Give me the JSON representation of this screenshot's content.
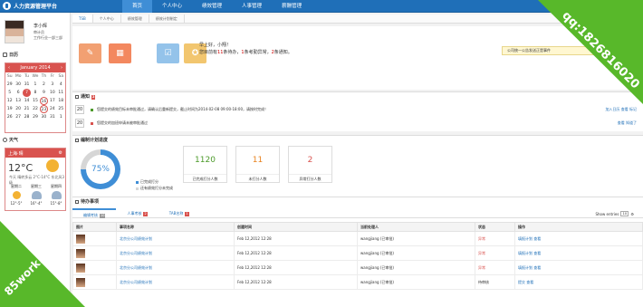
{
  "app": {
    "title": "人力资源管理平台"
  },
  "nav": {
    "items": [
      {
        "label": "首页",
        "active": true
      },
      {
        "label": "个人中心"
      },
      {
        "label": "绩效管理"
      },
      {
        "label": "人事管理"
      },
      {
        "label": "薪酬管理"
      }
    ]
  },
  "user": {
    "name": "李小辉",
    "role": "审计员",
    "dept": "工作行业一部三部"
  },
  "sidebar": {
    "calendar_title": "日历",
    "weather_title": "天气"
  },
  "calendar": {
    "month": "January 2014",
    "dow": [
      "Su",
      "Mo",
      "Tu",
      "We",
      "Th",
      "Fr",
      "Sa"
    ],
    "days": [
      "29",
      "30",
      "31",
      "1",
      "2",
      "3",
      "4",
      "5",
      "6",
      "7",
      "8",
      "9",
      "10",
      "11",
      "12",
      "13",
      "14",
      "15",
      "16",
      "17",
      "18",
      "19",
      "20",
      "21",
      "22",
      "23",
      "24",
      "25",
      "26",
      "27",
      "28",
      "29",
      "30",
      "31",
      "1"
    ],
    "current": "7",
    "marked": [
      "16",
      "23"
    ]
  },
  "weather": {
    "city": "上海·晴",
    "temp": "12°C",
    "today": "今天 晴转多云 2°C-14°C 东北风3级",
    "days": [
      {
        "name": "星期二",
        "range": "12°-5°"
      },
      {
        "name": "星期三",
        "range": "16°-4°"
      },
      {
        "name": "星期四",
        "range": "15°-8°"
      }
    ]
  },
  "tabs": [
    {
      "label": "TSB",
      "active": true
    },
    {
      "label": "个人中心"
    },
    {
      "label": "绩效管理"
    },
    {
      "label": "绩效计划制定"
    }
  ],
  "greeting": {
    "line1": "早上好，小翔！",
    "line2_pre": "您目前有",
    "count1": "11",
    "line2_mid": "条待办，",
    "count2": "1",
    "line2_mid2": "条考勤异常，",
    "count3": "2",
    "line2_post": "条通知。"
  },
  "alert": {
    "text": "公司统一公告发送正是事件"
  },
  "notice": {
    "title": "通知",
    "badge": "2",
    "rows": [
      {
        "date": "20",
        "text": "您提交的绩效目标未审批通过，请确认后重新提交，截止时间为2014-02-08 09:00-18:00，请按时完成！",
        "action1": "加入日历",
        "action2": "查看",
        "action3": "标记"
      },
      {
        "date": "20",
        "text": "您提交的加班申请未被审批通过",
        "action1": "",
        "action2": "查看",
        "action3": "知道了"
      }
    ]
  },
  "plan": {
    "title": "编制计划进度",
    "percent": "75%",
    "legend1": "已完成打分",
    "legend2": "还有绩效打分未完成",
    "stats": [
      {
        "num": "1120",
        "label": "已完成打分人数",
        "color": "#4c9a2a"
      },
      {
        "num": "11",
        "label": "未打分人数",
        "color": "#e8831f"
      },
      {
        "num": "2",
        "label": "异常打分人数",
        "color": "#d9534f"
      }
    ]
  },
  "todo": {
    "title": "待办事项",
    "tabs": [
      {
        "label": "编辑考核",
        "badge": "10",
        "active": true
      },
      {
        "label": "人事考核",
        "badge": "2"
      },
      {
        "label": "TAB名称",
        "badge": "1"
      }
    ],
    "show": "Show entries",
    "show_val": "10",
    "headers": [
      "图片",
      "事项名称",
      "创建时间",
      "当前处理人",
      "状态",
      "操作"
    ],
    "rows": [
      {
        "name": "北京分公司绩效计划",
        "time": "Feb 12,2012 12:28",
        "owner": "wangjiang (已审批)",
        "status": "异常",
        "op1": "填报计划",
        "op2": "查看"
      },
      {
        "name": "北京分公司绩效计划",
        "time": "Feb 12,2012 12:28",
        "owner": "wangjiang (已审批)",
        "status": "异常",
        "op1": "填报计划",
        "op2": "查看"
      },
      {
        "name": "北京分公司绩效计划",
        "time": "Feb 12,2012 12:28",
        "owner": "wangjiang (已审批)",
        "status": "异常",
        "op1": "填报计划",
        "op2": "查看"
      },
      {
        "name": "北京分公司绩效计划",
        "time": "Feb 12,2012 12:28",
        "owner": "wangjiang (已审批)",
        "status": "待审核",
        "op1": "提交",
        "op2": "查看"
      }
    ]
  },
  "watermark": {
    "top": "qq:1826816020",
    "bottom": "85work.com"
  }
}
